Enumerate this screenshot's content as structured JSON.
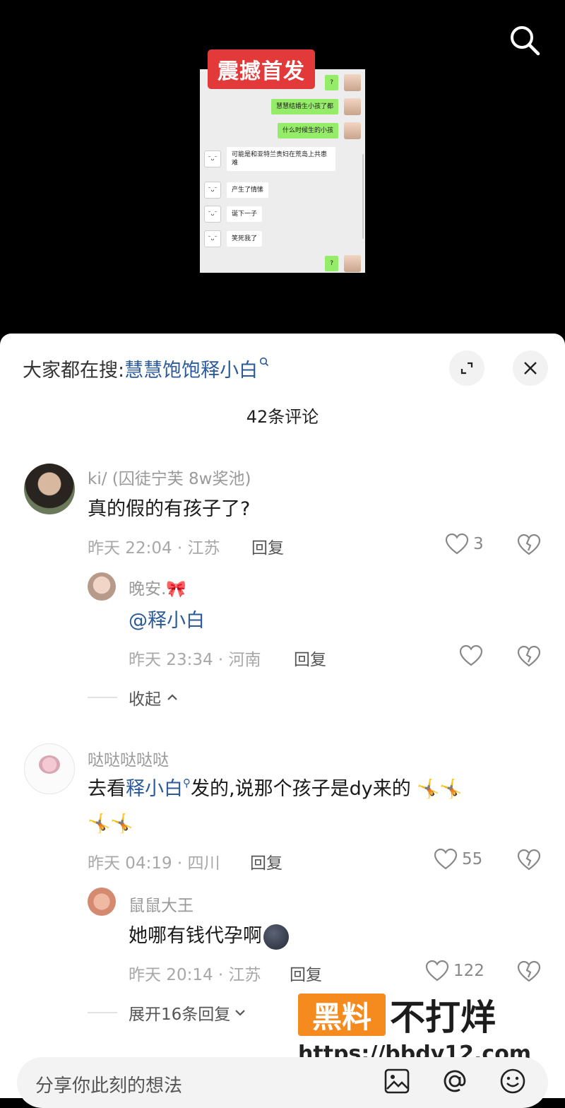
{
  "video": {
    "badge": "震撼首发",
    "chat": [
      {
        "side": "right",
        "text": "?"
      },
      {
        "side": "right",
        "text": "慧慧结婚生小孩了都"
      },
      {
        "side": "right",
        "text": "什么时候生的小孩"
      },
      {
        "side": "left",
        "text": "可能是和亚特兰贵妇在荒岛上共患难"
      },
      {
        "side": "left",
        "text": "产生了情愫"
      },
      {
        "side": "left",
        "text": "诞下一子"
      },
      {
        "side": "left",
        "text": "笑死我了"
      },
      {
        "side": "right",
        "text": "?"
      }
    ]
  },
  "sheet": {
    "hot_label": "大家都在搜:",
    "hot_keyword": "慧慧饱饱释小白",
    "comment_count": "42条评论"
  },
  "comments": {
    "c1": {
      "user": "ki/ (囚徒宁芙 8w奖池)",
      "text": "真的假的有孩子了?",
      "meta": "昨天 22:04 · 江苏",
      "reply": "回复",
      "likes": "3"
    },
    "r1": {
      "user": "晚安.🎀",
      "text": "@释小白",
      "meta": "昨天 23:34 · 河南",
      "reply": "回复",
      "likes": ""
    },
    "collapse": "收起",
    "c2": {
      "user": "哒哒哒哒哒",
      "text_before": "去看",
      "text_link": "释小白",
      "text_after": "发的,说那个孩子是dy来的",
      "meta": "昨天 04:19 · 四川",
      "reply": "回复",
      "likes": "55"
    },
    "r2": {
      "user": "鼠鼠大王",
      "text": "她哪有钱代孕啊",
      "meta": "昨天 20:14 · 江苏",
      "reply": "回复",
      "likes": "122"
    },
    "expand": "展开16条回复"
  },
  "watermark": {
    "hei": "黑料",
    "bu": "不打烊",
    "url": "https://bbdy12.com"
  },
  "input": {
    "placeholder": "分享你此刻的想法"
  },
  "icons": [
    "search-icon",
    "expand-icon",
    "close-icon",
    "heart-icon",
    "broken-heart-icon",
    "image-icon",
    "at-icon",
    "emoji-icon"
  ]
}
